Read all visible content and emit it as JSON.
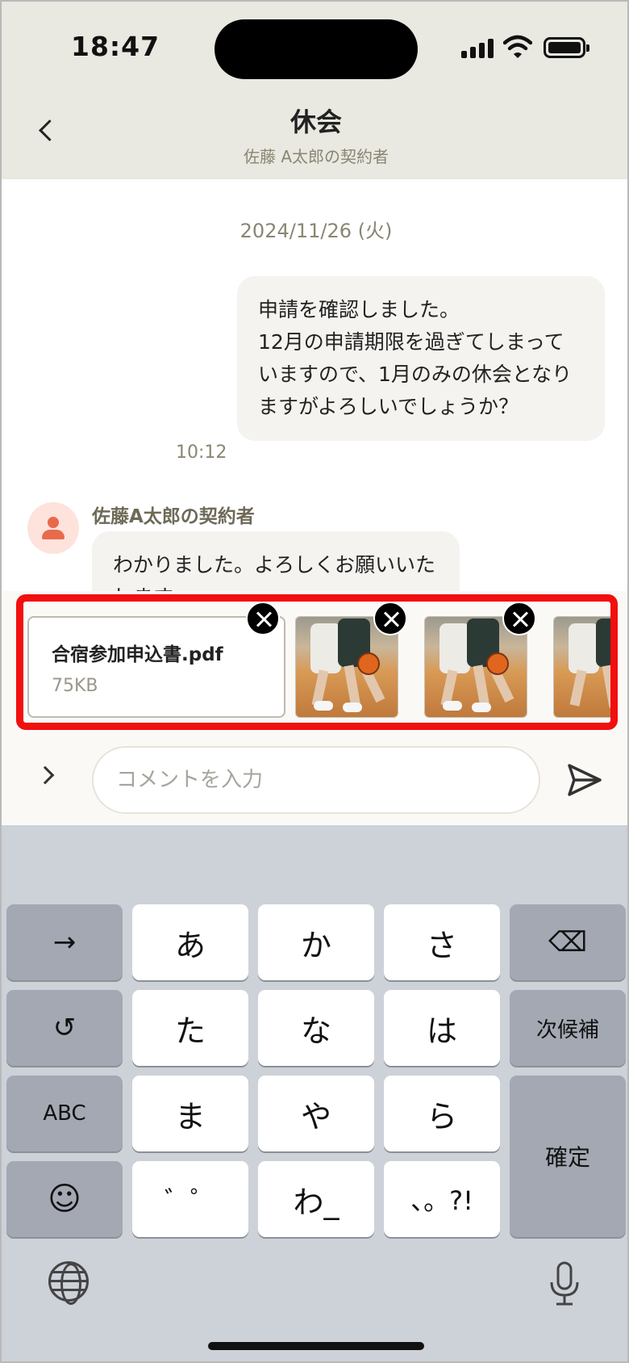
{
  "status_bar": {
    "time": "18:47"
  },
  "header": {
    "title": "休会",
    "subtitle": "佐藤 A太郎の契約者"
  },
  "chat": {
    "date": "2024/11/26 (火)",
    "outgoing": {
      "text": "申請を確認しました。\n12月の申請期限を過ぎてしまっていますので、1月のみの休会となりますがよろしいでしょうか？",
      "time": "10:12"
    },
    "incoming": {
      "sender": "佐藤A太郎の契約者",
      "text": "わかりました。よろしくお願いいたします。"
    }
  },
  "attachments": {
    "file": {
      "name": "合宿参加申込書.pdf",
      "size": "75KB"
    },
    "images": [
      "basketball-photo",
      "basketball-photo",
      "basketball-photo"
    ]
  },
  "composer": {
    "placeholder": "コメントを入力"
  },
  "keyboard": {
    "row1": [
      "→",
      "あ",
      "か",
      "さ",
      "⌫"
    ],
    "row2": [
      "↺",
      "た",
      "な",
      "は",
      "次候補"
    ],
    "row3": [
      "ABC",
      "ま",
      "や",
      "ら"
    ],
    "row4": [
      "☺",
      "゛゜",
      "わ_",
      "、。?!"
    ],
    "confirm": "確定"
  }
}
